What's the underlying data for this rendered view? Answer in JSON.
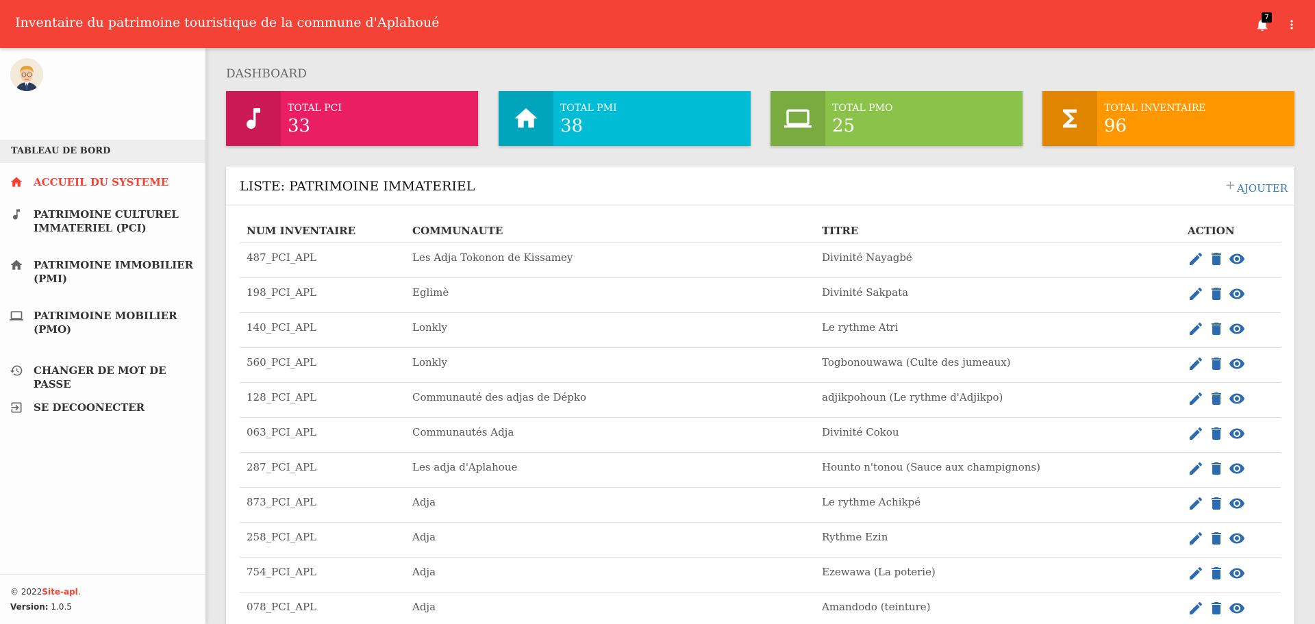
{
  "header": {
    "title": "Inventaire du patrimoine touristique de la commune d'Aplahoué",
    "notification_count": "7",
    "icons": [
      "bell-icon",
      "more-vert-icon"
    ]
  },
  "sidebar": {
    "section_label": "TABLEAU DE BORD",
    "items": [
      {
        "label": "ACCUEIL DU SYSTEME",
        "icon": "home-icon",
        "active": true
      },
      {
        "label": "PATRIMOINE CULTUREL IMMATERIEL (PCI)",
        "icon": "music-note-icon"
      },
      {
        "label": "PATRIMOINE IMMOBILIER (PMI)",
        "icon": "home-icon"
      },
      {
        "label": "PATRIMOINE MOBILIER (PMO)",
        "icon": "laptop-icon"
      },
      {
        "label": "CHANGER DE MOT DE PASSE",
        "icon": "refresh-icon"
      },
      {
        "label": "SE DECOONECTER",
        "icon": "logout-icon"
      }
    ],
    "footer": {
      "copyright": "© 2022",
      "brand": "Site-apl",
      "dot": ".",
      "version_label": "Version:",
      "version": "1.0.5"
    }
  },
  "dashboard": {
    "title": "DASHBOARD",
    "cards": [
      {
        "label": "TOTAL PCI",
        "value": "33",
        "icon": "music-note-icon",
        "color": "#e91e63",
        "icon_bg": "#cc1a57"
      },
      {
        "label": "TOTAL PMI",
        "value": "38",
        "icon": "home-icon",
        "color": "#00bcd4",
        "icon_bg": "#00a5bb"
      },
      {
        "label": "TOTAL PMO",
        "value": "25",
        "icon": "laptop-icon",
        "color": "#8bc34a",
        "icon_bg": "#7aab41"
      },
      {
        "label": "TOTAL INVENTAIRE",
        "value": "96",
        "icon": "sigma-icon",
        "color": "#ff9800",
        "icon_bg": "#e08600"
      }
    ]
  },
  "list": {
    "title": "LISTE: PATRIMOINE IMMATERIEL",
    "add_label": "AJOUTER",
    "columns": [
      "NUM INVENTAIRE",
      "COMMUNAUTE",
      "TITRE",
      "ACTION"
    ],
    "rows": [
      [
        "487_PCI_APL",
        "Les Adja Tokonon de Kissamey",
        "Divinité Nayagbé"
      ],
      [
        "198_PCI_APL",
        "Eglimè",
        "Divinité Sakpata"
      ],
      [
        "140_PCI_APL",
        "Lonkly",
        "Le rythme Atri"
      ],
      [
        "560_PCI_APL",
        "Lonkly",
        "Togbonouwawa (Culte des jumeaux)"
      ],
      [
        "128_PCI_APL",
        "Communauté des adjas de Dépko",
        "adjikpohoun (Le rythme d'Adjikpo)"
      ],
      [
        "063_PCI_APL",
        "Communautés Adja",
        "Divinité Cokou"
      ],
      [
        "287_PCI_APL",
        "Les adja d'Aplahoue",
        "Hounto n'tonou (Sauce aux champignons)"
      ],
      [
        "873_PCI_APL",
        "Adja",
        "Le rythme Achikpé"
      ],
      [
        "258_PCI_APL",
        "Adja",
        "Rythme Ezin"
      ],
      [
        "754_PCI_APL",
        "Adja",
        "Ezewawa (La poterie)"
      ],
      [
        "078_PCI_APL",
        "Adja",
        "Amandodo (teinture)"
      ]
    ],
    "row_action_icons": [
      "edit-icon",
      "delete-icon",
      "view-icon"
    ],
    "accent_color": "#2d6bb0"
  },
  "theme": {
    "primary": "#f44336"
  }
}
